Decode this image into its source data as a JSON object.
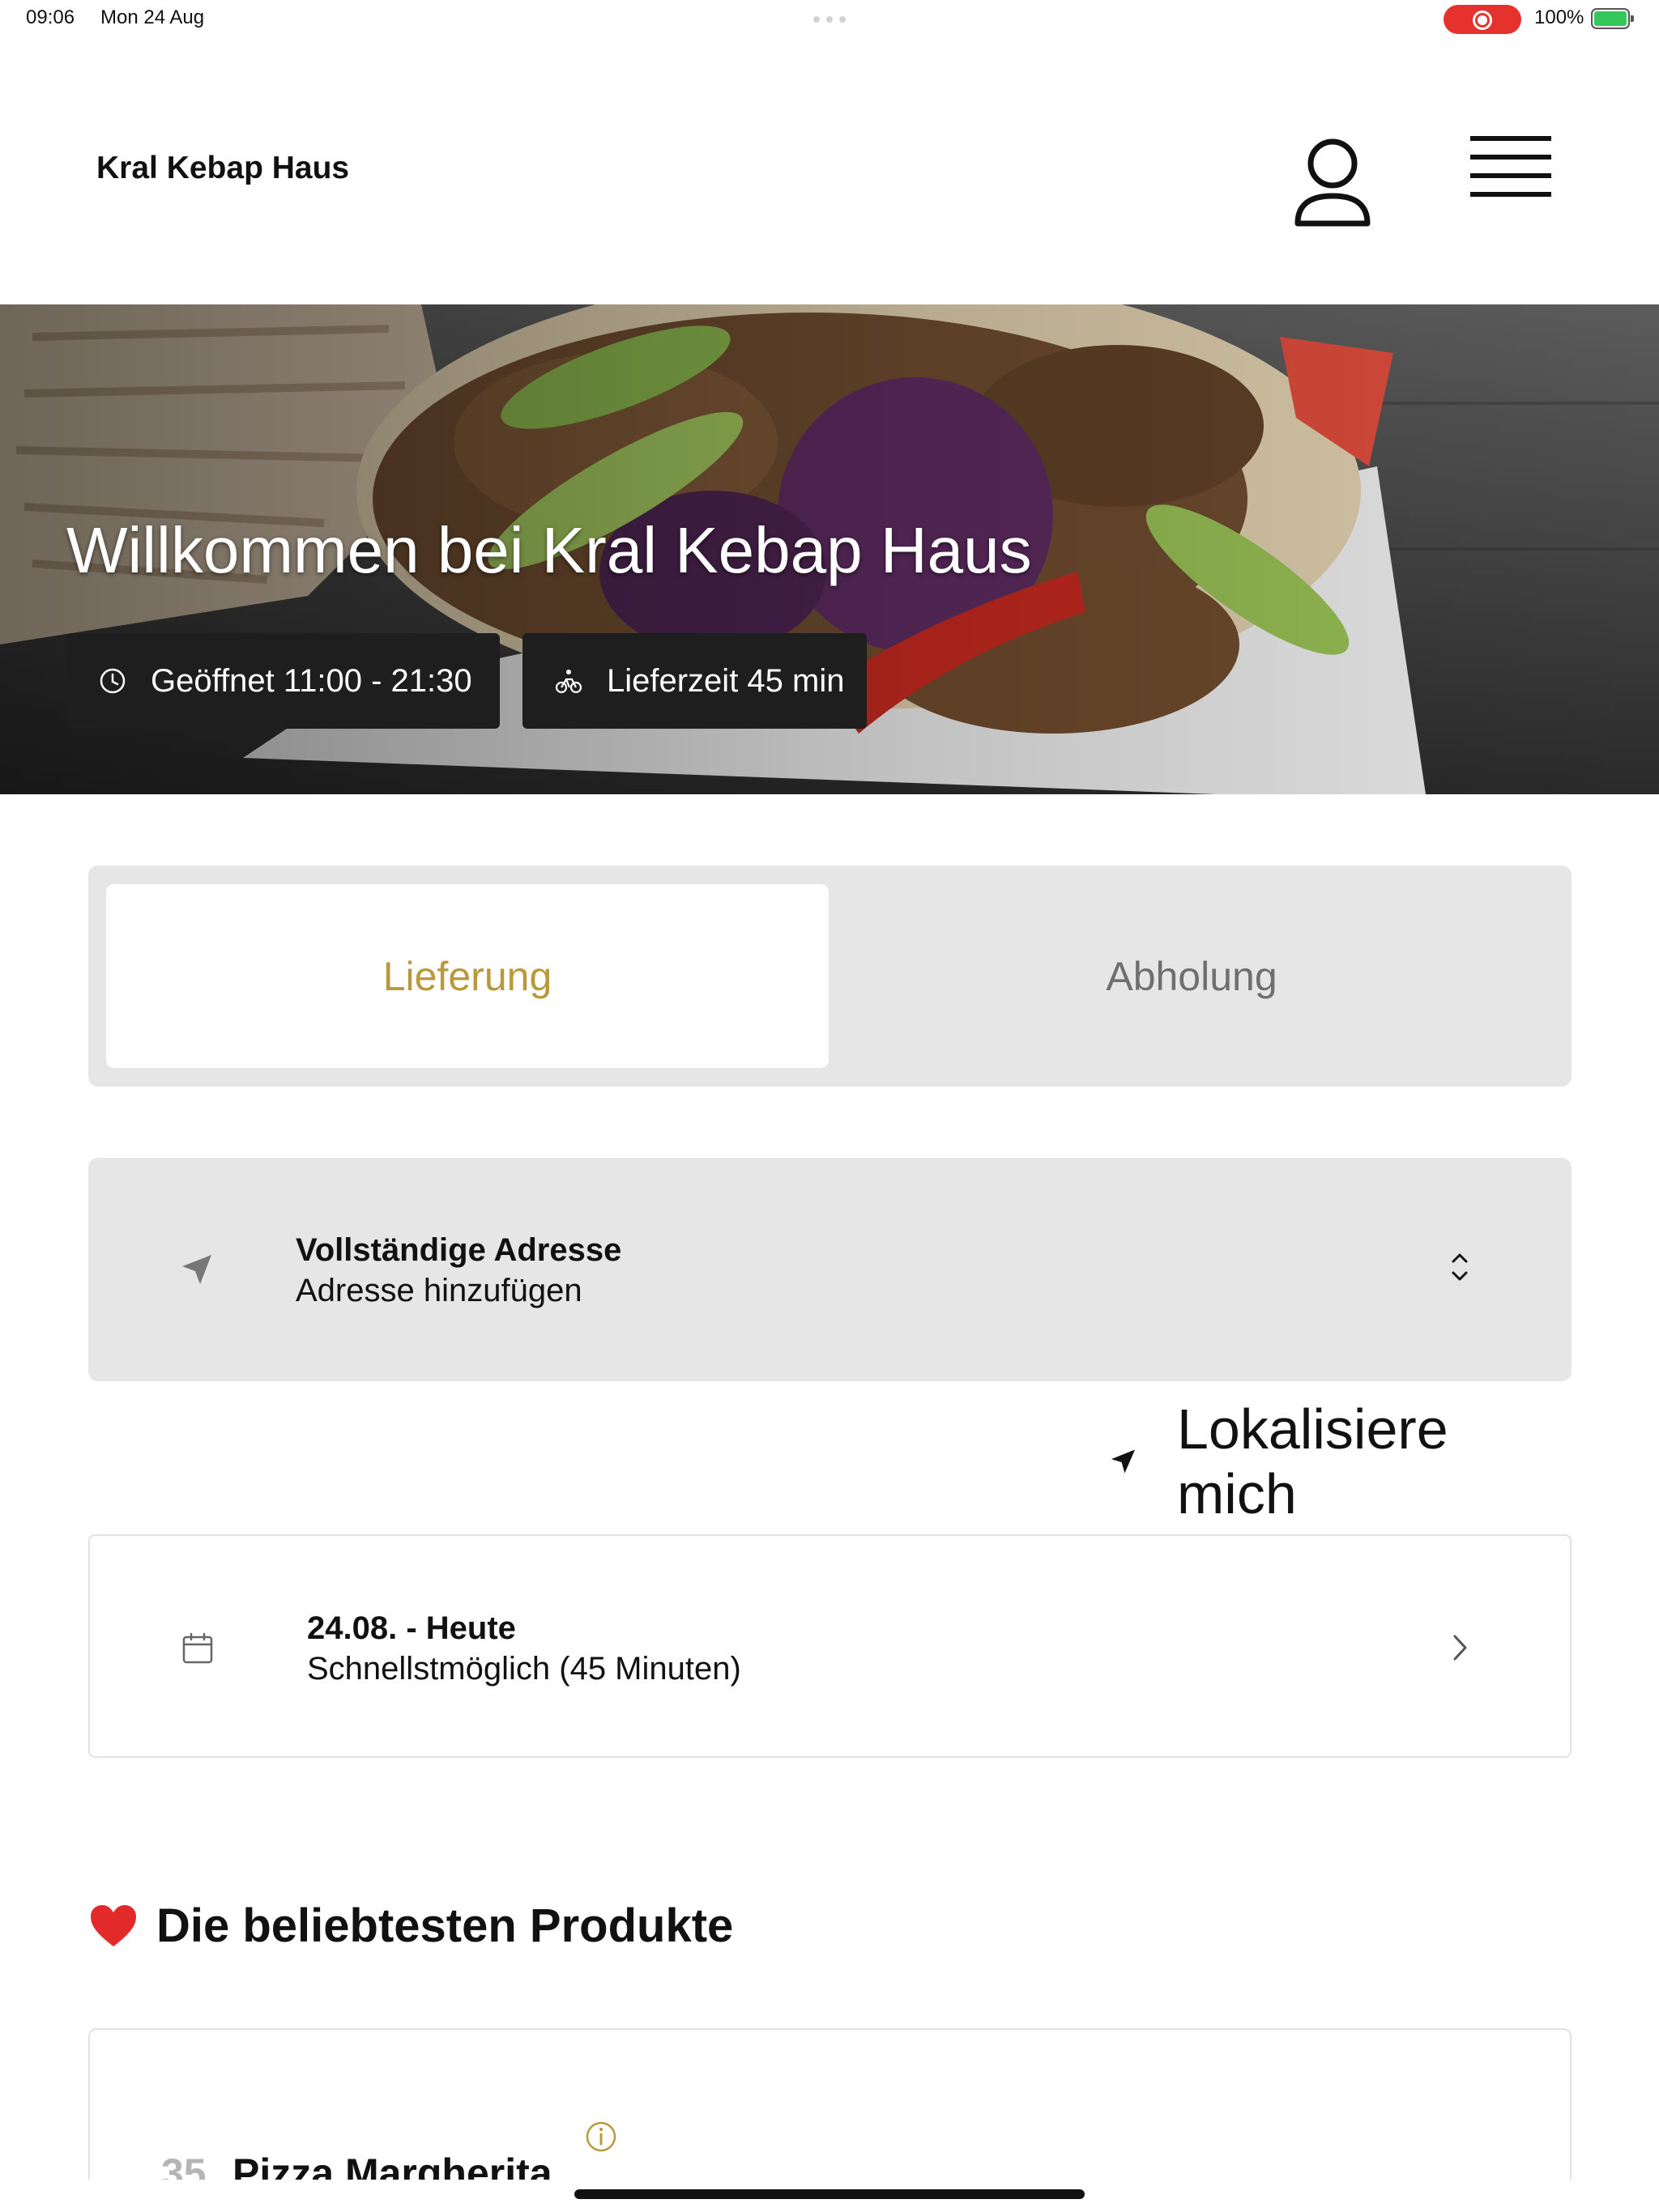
{
  "status_bar": {
    "time": "09:06",
    "date": "Mon 24 Aug",
    "battery": "100%",
    "recording_color": "#e5322d",
    "battery_color": "#34c759"
  },
  "header": {
    "brand": "Kral Kebap Haus",
    "icons": [
      "user-icon",
      "menu-icon"
    ]
  },
  "hero": {
    "title": "Willkommen bei Kral Kebap Haus",
    "opening_hours": "Geöffnet 11:00 - 21:30",
    "delivery_time": "Lieferzeit 45 min",
    "icons": [
      "clock-icon",
      "bike-icon"
    ]
  },
  "order_mode": {
    "options": [
      "Lieferung",
      "Abholung"
    ],
    "selected": "Lieferung",
    "active_color": "#b89a3c",
    "inactive_color": "#6f6f6f"
  },
  "address": {
    "label": "Vollständige Adresse",
    "value": "Adresse hinzufügen",
    "icons": [
      "navigation-arrow-icon",
      "chevron-up-down-icon"
    ]
  },
  "locate": {
    "label": "Lokalisiere mich",
    "icon": "location-arrow-icon"
  },
  "schedule": {
    "label": "24.08. - Heute",
    "value": "Schnellstmöglich (45 Minuten)",
    "icons": [
      "calendar-icon",
      "chevron-right-icon"
    ]
  },
  "popular": {
    "title": "Die beliebtesten Produkte",
    "icon": "heart-icon",
    "products": [
      {
        "number": "35",
        "name": "Pizza Margherita",
        "icon": "info-icon"
      }
    ]
  }
}
